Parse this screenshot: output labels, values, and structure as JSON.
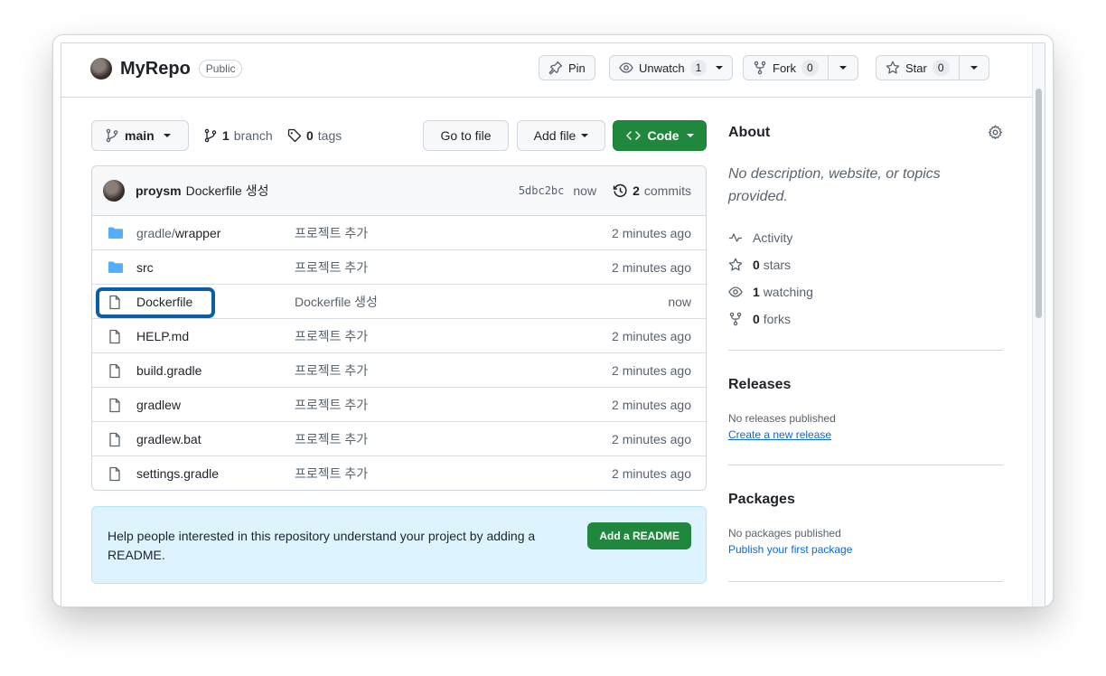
{
  "repo": {
    "name": "MyRepo",
    "visibility": "Public"
  },
  "header_actions": {
    "pin_label": "Pin",
    "unwatch_label": "Unwatch",
    "watch_count": "1",
    "fork_label": "Fork",
    "fork_count": "0",
    "star_label": "Star",
    "star_count": "0"
  },
  "toolbar": {
    "branch_name": "main",
    "branches_count": "1",
    "branches_label": "branch",
    "tags_count": "0",
    "tags_label": "tags",
    "go_to_file_label": "Go to file",
    "add_file_label": "Add file",
    "code_label": "Code"
  },
  "latest_commit": {
    "author": "proysm",
    "message": "Dockerfile 생성",
    "sha": "5dbc2bc",
    "time": "now",
    "commits_count": "2",
    "commits_label": "commits"
  },
  "files": [
    {
      "type": "folder",
      "name_prefix": "gradle/",
      "name": "wrapper",
      "message": "프로젝트 추가",
      "age": "2 minutes ago"
    },
    {
      "type": "folder",
      "name_prefix": "",
      "name": "src",
      "message": "프로젝트 추가",
      "age": "2 minutes ago"
    },
    {
      "type": "file",
      "name_prefix": "",
      "name": "Dockerfile",
      "message": "Dockerfile 생성",
      "age": "now"
    },
    {
      "type": "file",
      "name_prefix": "",
      "name": "HELP.md",
      "message": "프로젝트 추가",
      "age": "2 minutes ago"
    },
    {
      "type": "file",
      "name_prefix": "",
      "name": "build.gradle",
      "message": "프로젝트 추가",
      "age": "2 minutes ago"
    },
    {
      "type": "file",
      "name_prefix": "",
      "name": "gradlew",
      "message": "프로젝트 추가",
      "age": "2 minutes ago"
    },
    {
      "type": "file",
      "name_prefix": "",
      "name": "gradlew.bat",
      "message": "프로젝트 추가",
      "age": "2 minutes ago"
    },
    {
      "type": "file",
      "name_prefix": "",
      "name": "settings.gradle",
      "message": "프로젝트 추가",
      "age": "2 minutes ago"
    }
  ],
  "readme_prompt": {
    "text": "Help people interested in this repository understand your project by adding a README.",
    "button_label": "Add a README"
  },
  "about": {
    "heading": "About",
    "description": "No description, website, or topics provided.",
    "activity_label": "Activity",
    "stars_count": "0",
    "stars_label": "stars",
    "watching_count": "1",
    "watching_label": "watching",
    "forks_count": "0",
    "forks_label": "forks"
  },
  "releases": {
    "heading": "Releases",
    "empty_text": "No releases published",
    "link_label": "Create a new release"
  },
  "packages": {
    "heading": "Packages",
    "empty_text": "No packages published",
    "link_label": "Publish your first package"
  },
  "colors": {
    "green": "#1f883d",
    "highlight": "#0a5ea8",
    "link": "#0969da",
    "folder": "#54aeff"
  }
}
